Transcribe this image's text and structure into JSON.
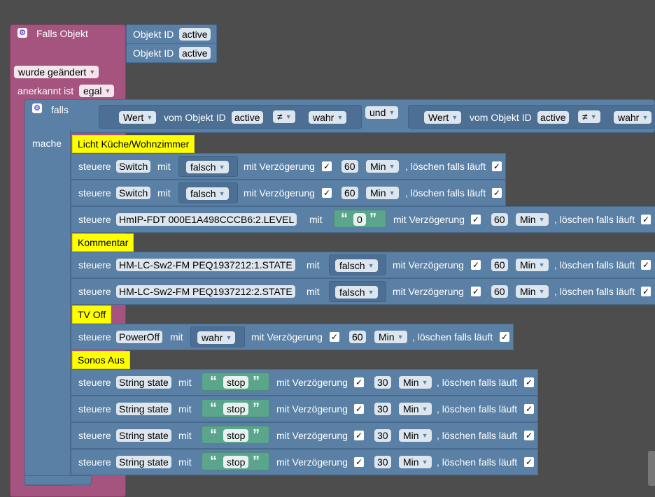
{
  "colors": {
    "workspace": "#4d4d4d",
    "event_block": "#a5547f",
    "logic_block": "#5b80a5",
    "text_block": "#5ba58c",
    "comment": "#ffff00"
  },
  "trigger": {
    "title": "Falls Objekt",
    "objects": [
      {
        "label": "Objekt ID",
        "value": "active"
      },
      {
        "label": "Objekt ID",
        "value": "active"
      }
    ],
    "change_option": "wurde geändert",
    "ack_label": "anerkannt ist",
    "ack_option": "egal"
  },
  "if_block": {
    "label": "falls",
    "do_label": "mache",
    "cond1": {
      "field": "Wert",
      "of_label": "vom Objekt ID",
      "id": "active",
      "op": "≠",
      "value": "wahr"
    },
    "join": "und",
    "cond2": {
      "field": "Wert",
      "of_label": "vom Objekt ID",
      "id": "active",
      "op": "≠",
      "value": "wahr"
    }
  },
  "common": {
    "control": "steuere",
    "with": "mit",
    "delay": "mit Verzögerung",
    "clear": ", löschen falls läuft",
    "check": "✓",
    "open_quote": "“",
    "close_quote": "”"
  },
  "comments": [
    "Licht Küche/Wohnzimmer",
    "Kommentar",
    "TV Off",
    "Sonos Aus"
  ],
  "rows": [
    {
      "target": "Switch",
      "value": "falsch",
      "delay": "60",
      "unit": "Min"
    },
    {
      "target": "Switch",
      "value": "falsch",
      "delay": "60",
      "unit": "Min"
    },
    {
      "target": "HmIP-FDT 000E1A498CCCB6:2.LEVEL",
      "value": "0",
      "delay": "60",
      "unit": "Min"
    },
    {
      "target": "HM-LC-Sw2-FM PEQ1937212:1.STATE",
      "value": "falsch",
      "delay": "60",
      "unit": "Min"
    },
    {
      "target": "HM-LC-Sw2-FM PEQ1937212:2.STATE",
      "value": "falsch",
      "delay": "60",
      "unit": "Min"
    },
    {
      "target": "PowerOff",
      "value": "wahr",
      "delay": "60",
      "unit": "Min"
    },
    {
      "target": "String state",
      "value": "stop",
      "delay": "30",
      "unit": "Min"
    },
    {
      "target": "String state",
      "value": "stop",
      "delay": "30",
      "unit": "Min"
    },
    {
      "target": "String state",
      "value": "stop",
      "delay": "30",
      "unit": "Min"
    },
    {
      "target": "String state",
      "value": "stop",
      "delay": "30",
      "unit": "Min"
    }
  ]
}
